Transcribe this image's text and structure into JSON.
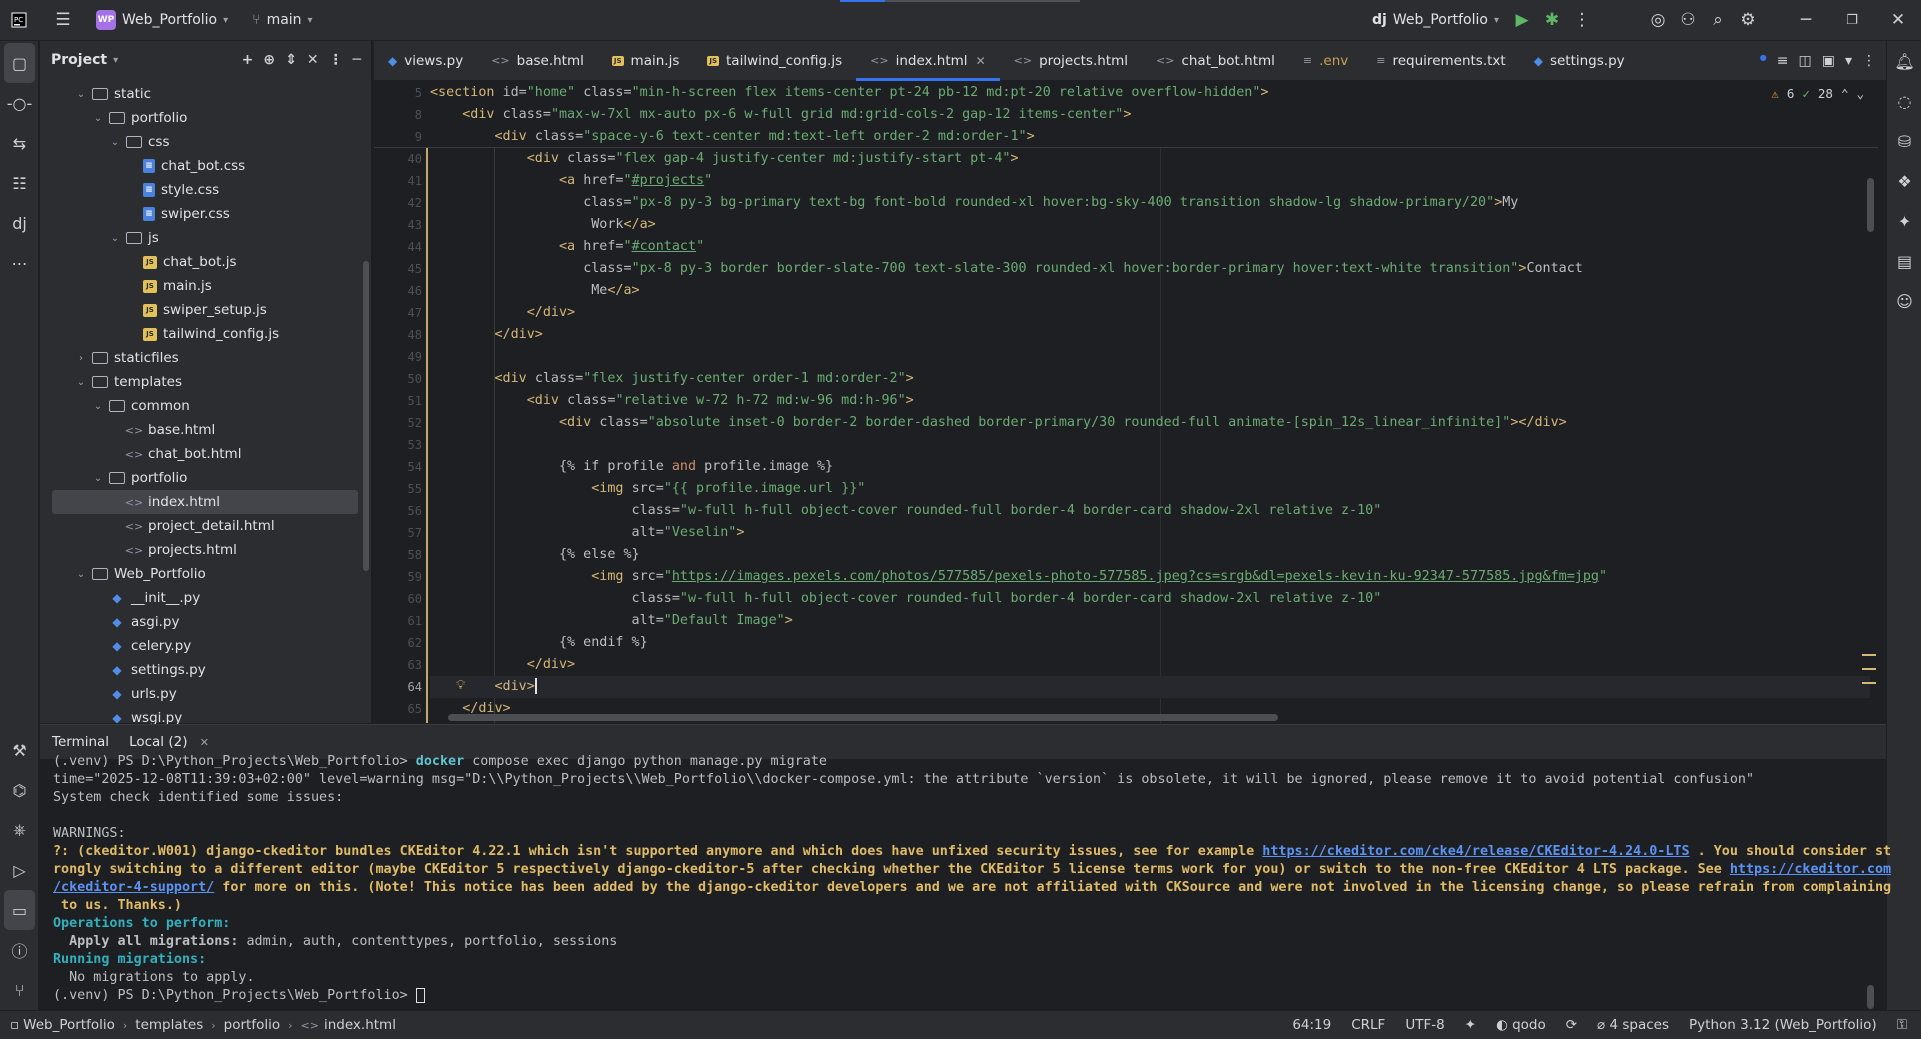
{
  "titlebar": {
    "project_badge": "WP",
    "project_name": "Web_Portfolio",
    "branch": "main",
    "run_config": "Web_Portfolio"
  },
  "project_panel": {
    "title": "Project",
    "tree": [
      {
        "indent": 2,
        "type": "folder",
        "open": true,
        "label": "static"
      },
      {
        "indent": 3,
        "type": "folder",
        "open": true,
        "label": "portfolio"
      },
      {
        "indent": 4,
        "type": "folder",
        "open": true,
        "label": "css"
      },
      {
        "indent": 5,
        "type": "css",
        "label": "chat_bot.css"
      },
      {
        "indent": 5,
        "type": "css",
        "label": "style.css"
      },
      {
        "indent": 5,
        "type": "css",
        "label": "swiper.css"
      },
      {
        "indent": 4,
        "type": "folder",
        "open": true,
        "label": "js"
      },
      {
        "indent": 5,
        "type": "js",
        "label": "chat_bot.js"
      },
      {
        "indent": 5,
        "type": "js",
        "label": "main.js"
      },
      {
        "indent": 5,
        "type": "js",
        "label": "swiper_setup.js"
      },
      {
        "indent": 5,
        "type": "js",
        "label": "tailwind_config.js"
      },
      {
        "indent": 2,
        "type": "folder",
        "open": false,
        "label": "staticfiles"
      },
      {
        "indent": 2,
        "type": "folder",
        "open": true,
        "label": "templates"
      },
      {
        "indent": 3,
        "type": "folder",
        "open": true,
        "label": "common"
      },
      {
        "indent": 4,
        "type": "html",
        "label": "base.html"
      },
      {
        "indent": 4,
        "type": "html",
        "label": "chat_bot.html"
      },
      {
        "indent": 3,
        "type": "folder",
        "open": true,
        "label": "portfolio"
      },
      {
        "indent": 4,
        "type": "html",
        "label": "index.html",
        "selected": true
      },
      {
        "indent": 4,
        "type": "html",
        "label": "project_detail.html"
      },
      {
        "indent": 4,
        "type": "html",
        "label": "projects.html"
      },
      {
        "indent": 2,
        "type": "folder",
        "open": true,
        "label": "Web_Portfolio"
      },
      {
        "indent": 3,
        "type": "py",
        "label": "__init__.py"
      },
      {
        "indent": 3,
        "type": "py",
        "label": "asgi.py"
      },
      {
        "indent": 3,
        "type": "py",
        "label": "celery.py"
      },
      {
        "indent": 3,
        "type": "py",
        "label": "settings.py"
      },
      {
        "indent": 3,
        "type": "py",
        "label": "urls.py"
      },
      {
        "indent": 3,
        "type": "py",
        "label": "wsgi.py"
      }
    ]
  },
  "tabs": [
    {
      "icon": "py",
      "label": "views.py"
    },
    {
      "icon": "html",
      "label": "base.html"
    },
    {
      "icon": "js",
      "label": "main.js"
    },
    {
      "icon": "js",
      "label": "tailwind_config.js"
    },
    {
      "icon": "html",
      "label": "index.html",
      "active": true
    },
    {
      "icon": "html",
      "label": "projects.html"
    },
    {
      "icon": "html",
      "label": "chat_bot.html"
    },
    {
      "icon": "env",
      "label": ".env"
    },
    {
      "icon": "txt",
      "label": "requirements.txt"
    },
    {
      "icon": "py",
      "label": "settings.py"
    }
  ],
  "editor": {
    "inspections": {
      "warnings": "6",
      "weak": "28"
    },
    "sticky_lines": [
      {
        "n": "5",
        "html": "<span class=\"tag\">&lt;section</span> <span class=\"at\">id=</span><span class=\"st\">\"home\"</span> <span class=\"at\">class=</span><span class=\"st\">\"min-h-screen flex items-center pt-24 pb-12 md:pt-20 relative overflow-hidden\"</span><span class=\"tag\">&gt;</span>"
      },
      {
        "n": "8",
        "html": "    <span class=\"tag\">&lt;div</span> <span class=\"at\">class=</span><span class=\"st\">\"max-w-7xl mx-auto px-6 w-full grid md:grid-cols-2 gap-12 items-center\"</span><span class=\"tag\">&gt;</span>"
      },
      {
        "n": "9",
        "html": "        <span class=\"tag\">&lt;div</span> <span class=\"at\">class=</span><span class=\"st\">\"space-y-6 text-center md:text-left order-2 md:order-1\"</span><span class=\"tag\">&gt;</span>"
      }
    ],
    "lines": [
      {
        "n": "40",
        "html": "            <span class=\"tag\">&lt;div</span> <span class=\"at\">class=</span><span class=\"st\">\"flex gap-4 justify-center md:justify-start pt-4\"</span><span class=\"tag\">&gt;</span>"
      },
      {
        "n": "41",
        "html": "                <span class=\"tag\">&lt;a</span> <span class=\"at\">href=</span><span class=\"st\">\"</span><span class=\"lk\">#projects</span><span class=\"st\">\"</span>"
      },
      {
        "n": "42",
        "html": "                   <span class=\"at\">class=</span><span class=\"st\">\"px-8 py-3 bg-primary text-bg font-bold rounded-xl hover:bg-sky-400 transition shadow-lg shadow-primary/20\"</span><span class=\"tag\">&gt;</span><span class=\"tx\">My</span>"
      },
      {
        "n": "43",
        "html": "                    <span class=\"tx\">Work</span><span class=\"tag\">&lt;/a&gt;</span>"
      },
      {
        "n": "44",
        "html": "                <span class=\"tag\">&lt;a</span> <span class=\"at\">href=</span><span class=\"st\">\"</span><span class=\"lk\">#contact</span><span class=\"st\">\"</span>"
      },
      {
        "n": "45",
        "html": "                   <span class=\"at\">class=</span><span class=\"st\">\"px-8 py-3 border border-slate-700 text-slate-300 rounded-xl hover:border-primary hover:text-white transition\"</span><span class=\"tag\">&gt;</span><span class=\"tx\">Contact</span>"
      },
      {
        "n": "46",
        "html": "                    <span class=\"tx\">Me</span><span class=\"tag\">&lt;/a&gt;</span>"
      },
      {
        "n": "47",
        "html": "            <span class=\"tag\">&lt;/div&gt;</span>"
      },
      {
        "n": "48",
        "html": "        <span class=\"tag\">&lt;/div&gt;</span>"
      },
      {
        "n": "49",
        "html": ""
      },
      {
        "n": "50",
        "html": "        <span class=\"tag\">&lt;div</span> <span class=\"at\">class=</span><span class=\"st\">\"flex justify-center order-1 md:order-2\"</span><span class=\"tag\">&gt;</span>"
      },
      {
        "n": "51",
        "html": "            <span class=\"tag\">&lt;div</span> <span class=\"at\">class=</span><span class=\"st\">\"relative w-72 h-72 md:w-96 md:h-96\"</span><span class=\"tag\">&gt;</span>"
      },
      {
        "n": "52",
        "html": "                <span class=\"tag\">&lt;div</span> <span class=\"at\">class=</span><span class=\"st\">\"absolute inset-0 border-2 border-dashed border-primary/30 rounded-full animate-[spin_12s_linear_infinite]\"</span><span class=\"tag\">&gt;&lt;/div&gt;</span>"
      },
      {
        "n": "53",
        "html": ""
      },
      {
        "n": "54",
        "html": "                <span class=\"tx\">{% </span><span class=\"tx\">if profile </span><span class=\"kw\">and</span><span class=\"tx\"> profile.image %}</span>"
      },
      {
        "n": "55",
        "html": "                    <span class=\"tag\">&lt;img</span> <span class=\"at\">src=</span><span class=\"st\">\"{{ profile.image.url }}\"</span>"
      },
      {
        "n": "56",
        "html": "                         <span class=\"at\">class=</span><span class=\"st\">\"w-full h-full object-cover rounded-full border-4 border-card shadow-2xl relative z-10\"</span>"
      },
      {
        "n": "57",
        "html": "                         <span class=\"at\">alt=</span><span class=\"st\">\"Veselin\"</span><span class=\"tag\">&gt;</span>"
      },
      {
        "n": "58",
        "html": "                <span class=\"tx\">{% else %}</span>"
      },
      {
        "n": "59",
        "html": "                    <span class=\"tag\">&lt;img</span> <span class=\"at\">src=</span><span class=\"st\">\"</span><span class=\"lk\">https://images.pexels.com/photos/577585/pexels-photo-577585.jpeg?cs=srgb&amp;dl=pexels-kevin-ku-92347-577585.jpg&amp;fm=jpg</span><span class=\"st\">\"</span>"
      },
      {
        "n": "60",
        "html": "                         <span class=\"at\">class=</span><span class=\"st\">\"w-full h-full object-cover rounded-full border-4 border-card shadow-2xl relative z-10\"</span>"
      },
      {
        "n": "61",
        "html": "                         <span class=\"at\">alt=</span><span class=\"st\">\"Default Image\"</span><span class=\"tag\">&gt;</span>"
      },
      {
        "n": "62",
        "html": "                <span class=\"tx\">{% endif %}</span>"
      },
      {
        "n": "63",
        "html": "            <span class=\"tag\">&lt;/div&gt;</span>"
      },
      {
        "n": "64",
        "html": "        <span class=\"tag\">&lt;div&gt;</span><span class=\"caret\"></span>",
        "current": true
      },
      {
        "n": "65",
        "html": "    <span class=\"tag\">&lt;/div&gt;</span>"
      }
    ]
  },
  "terminal": {
    "title": "Terminal",
    "tab": "Local (2)",
    "lines": [
      {
        "cls": "",
        "html": "(.venv) PS D:\\Python_Projects\\Web_Portfolio&gt; <span class=\"cyb\">docker</span> compose exec django python manage.py migrate"
      },
      {
        "cls": "",
        "html": "time=\"2025-12-08T11:39:03+02:00\" level=warning msg=\"D:\\\\Python_Projects\\\\Web_Portfolio\\\\docker-compose.yml: the attribute `version` is obsolete, it will be ignored, please remove it to avoid potential confusion\""
      },
      {
        "cls": "",
        "html": "System check identified some issues:"
      },
      {
        "cls": "",
        "html": ""
      },
      {
        "cls": "",
        "html": "WARNINGS:"
      },
      {
        "cls": "warn",
        "html": "?: (ckeditor.W001) django-ckeditor bundles CKEditor 4.22.1 which isn't supported anymore and which does have unfixed security issues, see for example <span class=\"lnk\">https://ckeditor.com/cke4/release/CKEditor-4.24.0-LTS</span> . You should consider st"
      },
      {
        "cls": "warn",
        "html": "rongly switching to a different editor (maybe CKEditor 5 respectively django-ckeditor-5 after checking whether the CKEditor 5 license terms work for you) or switch to the non-free CKEditor 4 LTS package. See <span class=\"lnk\">https://ckeditor.com</span>"
      },
      {
        "cls": "warn",
        "html": "<span class=\"lnk\">/ckeditor-4-support/</span> for more on this. (Note! This notice has been added by the django-ckeditor developers and we are not affiliated with CKSource and were not involved in the licensing change, so please refrain from complaining"
      },
      {
        "cls": "warn",
        "html": " to us. Thanks.)"
      },
      {
        "cls": "",
        "html": "<span class=\"cy\">Operations to perform:</span>"
      },
      {
        "cls": "",
        "html": "  <b>Apply all migrations:</b> admin, auth, contenttypes, portfolio, sessions"
      },
      {
        "cls": "",
        "html": "<span class=\"cy\">Running migrations:</span>"
      },
      {
        "cls": "",
        "html": "  No migrations to apply."
      },
      {
        "cls": "",
        "html": "(.venv) PS D:\\Python_Projects\\Web_Portfolio&gt; <span class=\"blk\"></span>"
      }
    ]
  },
  "statusbar": {
    "breadcrumb": [
      "Web_Portfolio",
      "templates",
      "portfolio",
      "index.html"
    ],
    "position": "64:19",
    "line_sep": "CRLF",
    "encoding": "UTF-8",
    "plugin": "qodo",
    "indent": "4 spaces",
    "interpreter": "Python 3.12 (Web_Portfolio)"
  }
}
